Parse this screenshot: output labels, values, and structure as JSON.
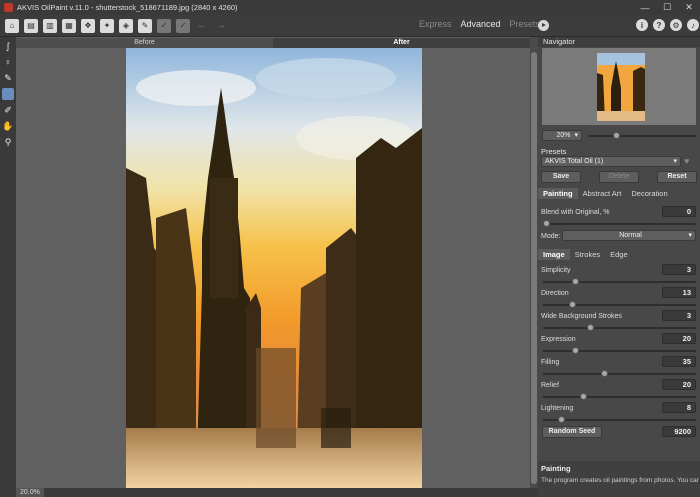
{
  "window": {
    "title": "AKVIS OilPaint v.11.0 - shutterstock_518671189.jpg (2840 x 4260)",
    "controls": [
      "—",
      "☐",
      "✕"
    ]
  },
  "toolbar": {
    "modes": [
      "Express",
      "Advanced",
      "Presets"
    ],
    "active_mode": "Advanced"
  },
  "view_tabs": {
    "before": "Before",
    "after": "After"
  },
  "status": {
    "zoom": "20.0%"
  },
  "navigator": {
    "title": "Navigator",
    "zoom": "20%",
    "zoom_level": 0.25
  },
  "presets": {
    "title": "Presets",
    "selected": "AKVIS Total Oil (1)",
    "save": "Save",
    "delete": "Delete",
    "reset": "Reset"
  },
  "effect_tabs": [
    "Painting",
    "Abstract Art",
    "Decoration"
  ],
  "blend": {
    "label": "Blend with Original, %",
    "value": "0",
    "level": 0.0
  },
  "mode": {
    "label": "Mode:",
    "value": "Normal"
  },
  "param_tabs": [
    "Image",
    "Strokes",
    "Edge"
  ],
  "params": [
    {
      "label": "Simplicity",
      "value": "3",
      "level": 0.2
    },
    {
      "label": "Direction",
      "value": "13",
      "level": 0.18
    },
    {
      "label": "Wide Background Strokes",
      "value": "3",
      "level": 0.3
    },
    {
      "label": "Expression",
      "value": "20",
      "level": 0.2
    },
    {
      "label": "Filling",
      "value": "35",
      "level": 0.4
    },
    {
      "label": "Relief",
      "value": "20",
      "level": 0.25
    },
    {
      "label": "Lightening",
      "value": "8",
      "level": 0.1
    }
  ],
  "random_seed": {
    "label": "Random Seed",
    "value": "9200"
  },
  "hint": {
    "title": "Painting",
    "body": "The program creates oil paintings from photos. You can adjust the effect parameters in the Painting tab"
  }
}
